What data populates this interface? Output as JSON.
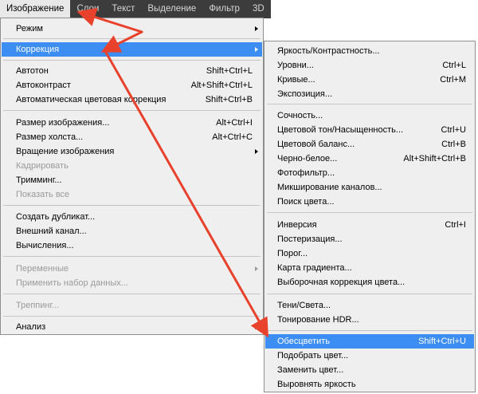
{
  "menubar": {
    "items": [
      "Изображение",
      "Слои",
      "Текст",
      "Выделение",
      "Фильтр",
      "3D"
    ],
    "active_index": 0
  },
  "image_menu": {
    "items": [
      {
        "label": "Режим",
        "shortcut": "",
        "submenu": true,
        "disabled": false
      },
      {
        "label": "Коррекция",
        "shortcut": "",
        "submenu": true,
        "disabled": false,
        "highlighted": true
      },
      {
        "label": "Автотон",
        "shortcut": "Shift+Ctrl+L",
        "disabled": false
      },
      {
        "label": "Автоконтраст",
        "shortcut": "Alt+Shift+Ctrl+L",
        "disabled": false
      },
      {
        "label": "Автоматическая цветовая коррекция",
        "shortcut": "Shift+Ctrl+B",
        "disabled": false
      },
      {
        "label": "Размер изображения...",
        "shortcut": "Alt+Ctrl+I",
        "disabled": false
      },
      {
        "label": "Размер холста...",
        "shortcut": "Alt+Ctrl+C",
        "disabled": false
      },
      {
        "label": "Вращение изображения",
        "shortcut": "",
        "submenu": true,
        "disabled": false
      },
      {
        "label": "Кадрировать",
        "shortcut": "",
        "disabled": true
      },
      {
        "label": "Тримминг...",
        "shortcut": "",
        "disabled": false
      },
      {
        "label": "Показать все",
        "shortcut": "",
        "disabled": true
      },
      {
        "label": "Создать дубликат...",
        "shortcut": "",
        "disabled": false
      },
      {
        "label": "Внешний канал...",
        "shortcut": "",
        "disabled": false
      },
      {
        "label": "Вычисления...",
        "shortcut": "",
        "disabled": false
      },
      {
        "label": "Переменные",
        "shortcut": "",
        "submenu": true,
        "disabled": true
      },
      {
        "label": "Применить набор данных...",
        "shortcut": "",
        "disabled": true
      },
      {
        "label": "Треппинг...",
        "shortcut": "",
        "disabled": true
      },
      {
        "label": "Анализ",
        "shortcut": "",
        "submenu": true,
        "disabled": false
      }
    ]
  },
  "correction_submenu": {
    "items": [
      {
        "label": "Яркость/Контрастность...",
        "shortcut": ""
      },
      {
        "label": "Уровни...",
        "shortcut": "Ctrl+L"
      },
      {
        "label": "Кривые...",
        "shortcut": "Ctrl+M"
      },
      {
        "label": "Экспозиция...",
        "shortcut": ""
      },
      {
        "label": "Сочность...",
        "shortcut": ""
      },
      {
        "label": "Цветовой тон/Насыщенность...",
        "shortcut": "Ctrl+U"
      },
      {
        "label": "Цветовой баланс...",
        "shortcut": "Ctrl+B"
      },
      {
        "label": "Черно-белое...",
        "shortcut": "Alt+Shift+Ctrl+B"
      },
      {
        "label": "Фотофильтр...",
        "shortcut": ""
      },
      {
        "label": "Микширование каналов...",
        "shortcut": ""
      },
      {
        "label": "Поиск цвета...",
        "shortcut": ""
      },
      {
        "label": "Инверсия",
        "shortcut": "Ctrl+I"
      },
      {
        "label": "Постеризация...",
        "shortcut": ""
      },
      {
        "label": "Порог...",
        "shortcut": ""
      },
      {
        "label": "Карта градиента...",
        "shortcut": ""
      },
      {
        "label": "Выборочная коррекция цвета...",
        "shortcut": ""
      },
      {
        "label": "Тени/Света...",
        "shortcut": ""
      },
      {
        "label": "Тонирование HDR...",
        "shortcut": ""
      },
      {
        "label": "Обесцветить",
        "shortcut": "Shift+Ctrl+U",
        "highlighted": true
      },
      {
        "label": "Подобрать цвет...",
        "shortcut": ""
      },
      {
        "label": "Заменить цвет...",
        "shortcut": ""
      },
      {
        "label": "Выровнять яркость",
        "shortcut": ""
      }
    ]
  },
  "colors": {
    "menubar_bg": "#3c3c3c",
    "menu_bg": "#efefef",
    "highlight": "#3d8ef2",
    "annotation_arrow": "#e8412c"
  }
}
